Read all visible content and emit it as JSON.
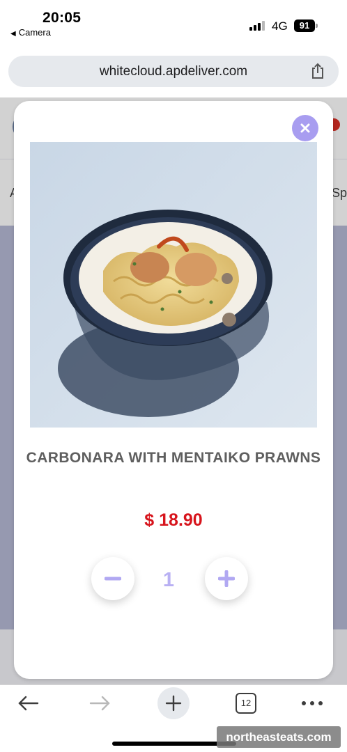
{
  "status_bar": {
    "time": "20:05",
    "back_app": "Camera",
    "network": "4G",
    "battery": "91"
  },
  "browser": {
    "url": "whitecloud.apdeliver.com",
    "tab_count": "12"
  },
  "background_page": {
    "category_left_partial": "A",
    "category_right_partial": "Sp"
  },
  "modal": {
    "item_name": "CARBONARA WITH MENTAIKO PRAWNS",
    "price": "$ 18.90",
    "quantity": "1",
    "accent_color": "#a89df0",
    "price_color": "#d7141c"
  },
  "icons": {
    "close": "close-icon",
    "minus": "minus-icon",
    "plus": "plus-icon",
    "share": "share-icon",
    "back": "arrow-left-icon",
    "forward": "arrow-right-icon",
    "new_tab": "plus-icon",
    "more": "ellipsis-icon"
  },
  "watermark": "northeasteats.com"
}
